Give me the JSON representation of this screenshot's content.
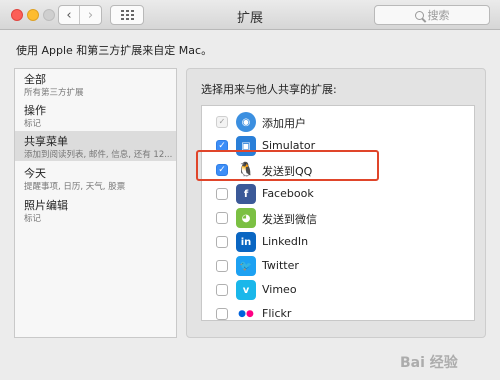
{
  "window": {
    "title": "扩展",
    "search_placeholder": "搜索",
    "back_glyph": "‹",
    "forward_glyph": "›"
  },
  "description": "使用 Apple 和第三方扩展来自定 Mac。",
  "sidebar": {
    "items": [
      {
        "title": "全部",
        "subtitle": "所有第三方扩展",
        "selected": false
      },
      {
        "title": "操作",
        "subtitle": "标记",
        "selected": false
      },
      {
        "title": "共享菜单",
        "subtitle": "添加到阅读列表, 邮件, 信息, 还有 12...",
        "selected": true
      },
      {
        "title": "今天",
        "subtitle": "提醒事项, 日历, 天气, 股票",
        "selected": false
      },
      {
        "title": "照片编辑",
        "subtitle": "标记",
        "selected": false
      }
    ]
  },
  "panel": {
    "title": "选择用来与他人共享的扩展:",
    "extensions": [
      {
        "label": "添加用户",
        "checked": true,
        "disabled": true,
        "icon": "add-person-icon",
        "color": "#3b8fe0"
      },
      {
        "label": "Simulator",
        "checked": true,
        "disabled": false,
        "icon": "simulator-icon",
        "color": "#2a7fd8"
      },
      {
        "label": "发送到QQ",
        "checked": true,
        "disabled": false,
        "icon": "qq-penguin-icon",
        "color": "#222222"
      },
      {
        "label": "Facebook",
        "checked": false,
        "disabled": false,
        "icon": "facebook-icon",
        "color": "#3b5998"
      },
      {
        "label": "发送到微信",
        "checked": false,
        "disabled": false,
        "icon": "wechat-icon",
        "color": "#7bc043"
      },
      {
        "label": "LinkedIn",
        "checked": false,
        "disabled": false,
        "icon": "linkedin-icon",
        "color": "#0a66c2"
      },
      {
        "label": "Twitter",
        "checked": false,
        "disabled": false,
        "icon": "twitter-icon",
        "color": "#1da1f2"
      },
      {
        "label": "Vimeo",
        "checked": false,
        "disabled": false,
        "icon": "vimeo-icon",
        "color": "#1ab7ea"
      },
      {
        "label": "Flickr",
        "checked": false,
        "disabled": false,
        "icon": "flickr-icon",
        "color": "#ff0084"
      }
    ]
  },
  "annotation": {
    "color": "#e0452a"
  },
  "watermark": "Bai 经验"
}
